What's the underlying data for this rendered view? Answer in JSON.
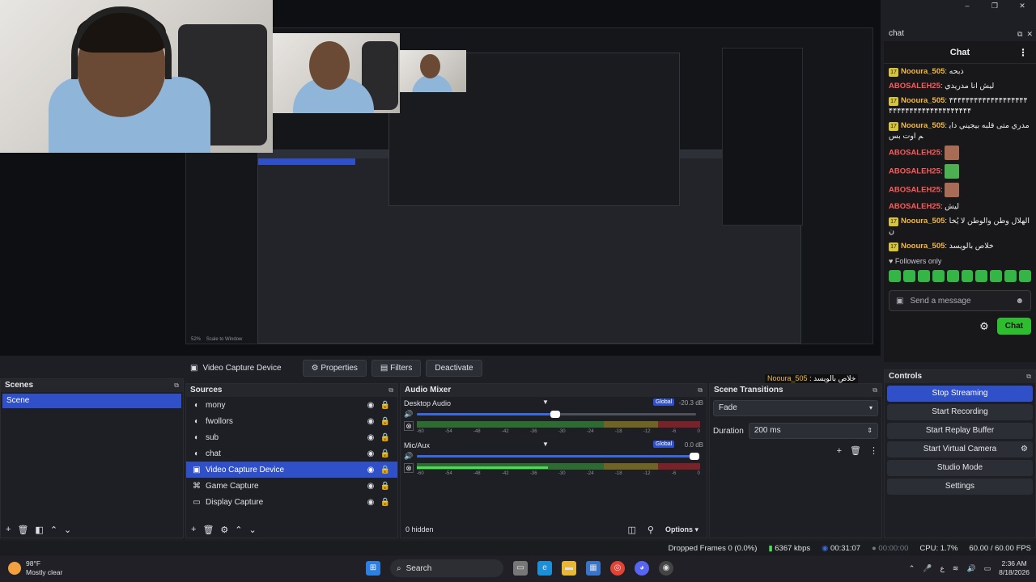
{
  "window": {
    "controls": [
      "–",
      "❐",
      "✕"
    ]
  },
  "preview": {
    "overlay_username": "Nooura_505",
    "overlay_message": ": خلاص بالويسد",
    "nested_zoom": "52%",
    "nested_scale": "Scale to Window"
  },
  "chat": {
    "dock_title": "chat",
    "header": "Chat",
    "messages": [
      {
        "user": "Nooura_505",
        "text": "ذبحه",
        "color": "u1",
        "badge": true
      },
      {
        "user": "ABOSALEH25",
        "text": "ليش انا مدريدي",
        "color": "u2",
        "badge": false
      },
      {
        "user": "Nooura_505",
        "text": "۴۴۴۴۴۴۴۴۴۴۴۴۴۴۴۴۴۴۴۴۴۴۴۴۴۴۴۴۴۴۴۴۴۴۴۴۴۴۴",
        "color": "u1",
        "badge": true
      },
      {
        "user": "Nooura_505",
        "text": "مدري متى قلبه بيجيني دايم اوت بس",
        "color": "u1",
        "badge": true
      },
      {
        "user": "ABOSALEH25",
        "text": "",
        "color": "u2",
        "badge": false,
        "emote": true
      },
      {
        "user": "ABOSALEH25",
        "text": "",
        "color": "u2",
        "badge": false,
        "emote": true,
        "green": true
      },
      {
        "user": "ABOSALEH25",
        "text": "",
        "color": "u2",
        "badge": false,
        "emote": true
      },
      {
        "user": "ABOSALEH25",
        "text": "ليش",
        "color": "u2",
        "badge": false
      },
      {
        "user": "Nooura_505",
        "text": "الهلال وطن والوطن لا يُخان",
        "color": "u1",
        "badge": true
      },
      {
        "user": "Nooura_505",
        "text": "خلاص بالويسد",
        "color": "u1",
        "badge": true
      }
    ],
    "followers_only": "Followers only",
    "placeholder": "Send a message",
    "chat_button": "Chat"
  },
  "toolbar": {
    "source_name": "Video Capture Device",
    "properties": "Properties",
    "filters": "Filters",
    "deactivate": "Deactivate"
  },
  "scenes": {
    "title": "Scenes",
    "items": [
      "Scene"
    ]
  },
  "sources": {
    "title": "Sources",
    "items": [
      {
        "name": "mony",
        "icon": "◐"
      },
      {
        "name": "fwollors",
        "icon": "◐"
      },
      {
        "name": "sub",
        "icon": "◐"
      },
      {
        "name": "chat",
        "icon": "◐"
      },
      {
        "name": "Video Capture Device",
        "icon": "▣"
      },
      {
        "name": "Game Capture",
        "icon": "⌘"
      },
      {
        "name": "Display Capture",
        "icon": "▭"
      }
    ]
  },
  "mixer": {
    "title": "Audio Mixer",
    "channels": [
      {
        "name": "Desktop Audio",
        "db": "-20.3 dB",
        "global": "Global",
        "volume": 0.5,
        "level": 0
      },
      {
        "name": "Mic/Aux",
        "db": "0.0 dB",
        "global": "Global",
        "volume": 1.0,
        "level": 0.7
      }
    ],
    "scale": [
      "-60",
      "-54",
      "-48",
      "-42",
      "-36",
      "-30",
      "-24",
      "-18",
      "-12",
      "-6",
      "0"
    ],
    "hidden": "0 hidden",
    "options": "Options"
  },
  "transitions": {
    "title": "Scene Transitions",
    "type": "Fade",
    "duration_label": "Duration",
    "duration": "200 ms"
  },
  "controls": {
    "title": "Controls",
    "buttons": [
      "Stop Streaming",
      "Start Recording",
      "Start Replay Buffer",
      "Start Virtual Camera",
      "Studio Mode",
      "Settings"
    ]
  },
  "status": {
    "dropped": "Dropped Frames 0 (0.0%)",
    "bitrate": "6367 kbps",
    "stream_time": "00:31:07",
    "rec_time": "00:00:00",
    "cpu": "CPU: 1.7%",
    "fps": "60.00 / 60.00 FPS"
  },
  "taskbar": {
    "temp": "98°F",
    "weather": "Mostly clear",
    "search": "Search",
    "time": "2:36 AM",
    "date": "8/18/2026",
    "lang": "ع"
  }
}
